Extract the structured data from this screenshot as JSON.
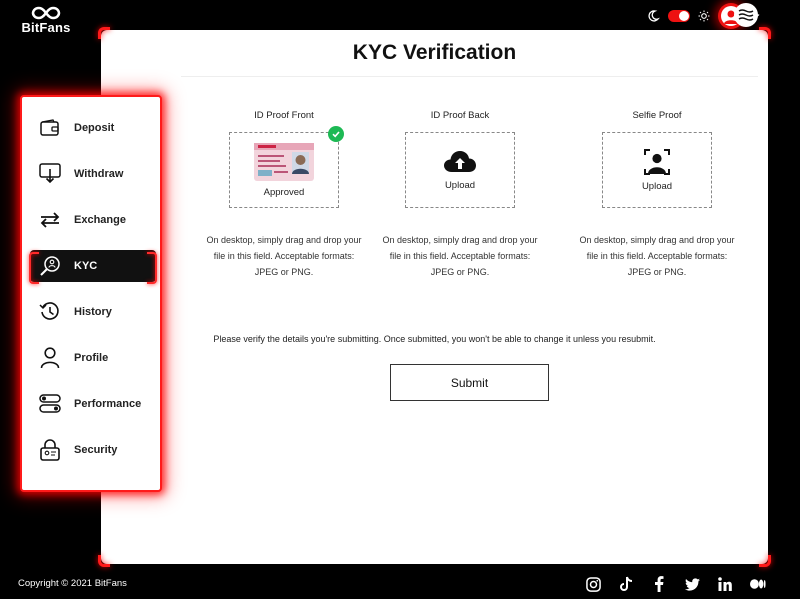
{
  "brand": {
    "name": "BitFans"
  },
  "header": {
    "theme_toggle": "dark-light-toggle",
    "icons": [
      "moon-icon",
      "sun-icon",
      "user-icon",
      "chevron-down-icon",
      "menu-icon"
    ]
  },
  "sidebar": {
    "items": [
      {
        "label": "Deposit",
        "icon": "wallet-icon"
      },
      {
        "label": "Withdraw",
        "icon": "withdraw-icon"
      },
      {
        "label": "Exchange",
        "icon": "exchange-icon"
      },
      {
        "label": "KYC",
        "icon": "kyc-icon",
        "active": true
      },
      {
        "label": "History",
        "icon": "history-icon"
      },
      {
        "label": "Profile",
        "icon": "profile-icon"
      },
      {
        "label": "Performance",
        "icon": "performance-icon"
      },
      {
        "label": "Security",
        "icon": "security-icon"
      }
    ]
  },
  "main": {
    "title": "KYC Verification",
    "proofs": [
      {
        "label": "ID Proof Front",
        "box_text": "Approved",
        "status": "approved",
        "description": "On desktop, simply drag and drop your file in this field. Acceptable formats: JPEG or PNG."
      },
      {
        "label": "ID Proof Back",
        "box_text": "Upload",
        "status": "pending",
        "description": "On desktop, simply drag and drop your file in this field. Acceptable formats: JPEG or PNG."
      },
      {
        "label": "Selfie Proof",
        "box_text": "Upload",
        "status": "pending",
        "description": "On desktop, simply drag and drop your file in this field. Acceptable formats: JPEG or PNG."
      }
    ],
    "notice": "Please verify the details you're submitting. Once submitted, you won't be able to change it unless you resubmit.",
    "submit_label": "Submit"
  },
  "footer": {
    "copyright": "Copyright © 2021 BitFans",
    "socials": [
      "instagram-icon",
      "tiktok-icon",
      "facebook-icon",
      "twitter-icon",
      "linkedin-icon",
      "medium-icon"
    ]
  },
  "colors": {
    "accent": "#ff1a1a",
    "approved": "#1db954",
    "background": "#000000",
    "card": "#ffffff"
  }
}
